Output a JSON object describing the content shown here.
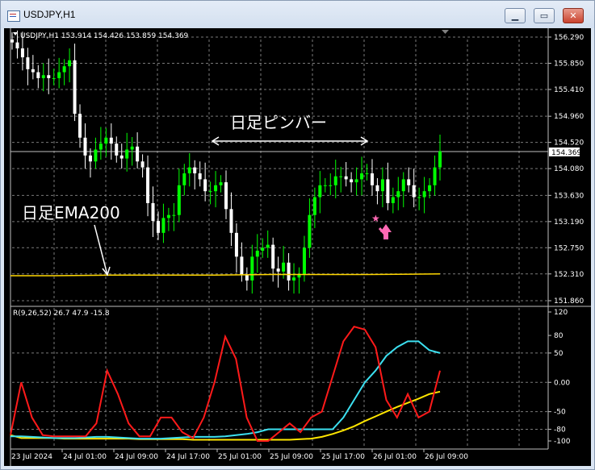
{
  "window": {
    "title": "USDJPY,H1",
    "buttons": {
      "minimize": "▁",
      "restore": "▭",
      "close": "✕"
    }
  },
  "main_chart": {
    "info": "USDJPY,H1  153.914 154.426 153.859 154.369",
    "current_price": "154.369",
    "price_ticks": [
      "156.290",
      "155.850",
      "155.410",
      "154.960",
      "154.520",
      "154.080",
      "153.630",
      "153.190",
      "152.750",
      "152.310",
      "151.860"
    ],
    "annotation_pinbar": "日足ピンバー",
    "annotation_ema": "日足EMA200",
    "colors": {
      "bull": "#00ff00",
      "bear": "#ffffff",
      "ema": "#ffd700",
      "arrow": "#ff69b4"
    }
  },
  "sub_chart": {
    "info": "R(9,26,52) 26.7 47.9 -15.8",
    "ticks": [
      "120",
      "80",
      "50",
      "0.00",
      "-50",
      "-80",
      "-100"
    ],
    "colors": {
      "red": "#ff1a1a",
      "cyan": "#3ce0f0",
      "yellow": "#ffe600"
    }
  },
  "time_axis": [
    "23 Jul 2024",
    "24 Jul 01:00",
    "24 Jul 09:00",
    "24 Jul 17:00",
    "25 Jul 01:00",
    "25 Jul 09:00",
    "25 Jul 17:00",
    "26 Jul 01:00",
    "26 Jul 09:00"
  ],
  "chart_data": [
    {
      "type": "candlestick",
      "title": "USDJPY,H1",
      "ylim": [
        151.86,
        156.29
      ],
      "close": [
        156.2,
        156.1,
        155.95,
        155.75,
        155.7,
        155.6,
        155.65,
        155.6,
        155.6,
        155.7,
        155.8,
        155.9,
        155.0,
        154.6,
        154.3,
        154.2,
        154.4,
        154.5,
        154.6,
        154.5,
        154.3,
        154.25,
        154.4,
        154.45,
        154.2,
        154.1,
        153.5,
        153.2,
        153.0,
        153.25,
        153.3,
        153.3,
        153.8,
        154.0,
        154.1,
        154.0,
        153.9,
        153.7,
        153.7,
        153.8,
        153.85,
        153.4,
        153.0,
        152.6,
        152.3,
        152.2,
        152.6,
        152.7,
        152.75,
        152.8,
        152.4,
        152.35,
        152.5,
        152.2,
        152.25,
        152.3,
        152.75,
        153.3,
        153.6,
        153.8,
        153.8,
        153.8,
        153.95,
        153.95,
        153.9,
        153.85,
        153.9,
        154.0,
        154.0,
        153.8,
        153.7,
        153.9,
        153.5,
        153.6,
        153.7,
        153.9,
        153.8,
        153.6,
        153.6,
        153.7,
        153.8,
        154.1,
        154.37
      ]
    },
    {
      "type": "line",
      "title": "R(9,26,52)",
      "ylim": [
        -100,
        120
      ],
      "series": [
        {
          "values": [
            -90,
            0,
            -60,
            -90,
            -92,
            -92,
            -92,
            -92,
            -70,
            20,
            -20,
            -70,
            -92,
            -92,
            -60,
            -60,
            -85,
            -95,
            -60,
            0,
            78,
            40,
            -60,
            -100,
            -100,
            -85,
            -70,
            -85,
            -60,
            -50,
            10,
            70,
            95,
            90,
            60,
            -30,
            -60,
            -20,
            -60,
            -50,
            20
          ]
        },
        {
          "values": [
            -92,
            -92,
            -93,
            -94,
            -95,
            -95,
            -95,
            -94,
            -93,
            -93,
            -94,
            -95,
            -96,
            -96,
            -96,
            -95,
            -94,
            -93,
            -93,
            -93,
            -92,
            -90,
            -88,
            -85,
            -80,
            -80,
            -80,
            -80,
            -80,
            -80,
            -80,
            -60,
            -30,
            0,
            20,
            45,
            60,
            70,
            70,
            55,
            50
          ]
        },
        {
          "values": [
            -90,
            -95,
            -95,
            -95,
            -95,
            -96,
            -96,
            -96,
            -96,
            -96,
            -96,
            -96,
            -97,
            -97,
            -97,
            -97,
            -97,
            -98,
            -98,
            -98,
            -98,
            -98,
            -98,
            -98,
            -98,
            -98,
            -98,
            -97,
            -96,
            -93,
            -88,
            -82,
            -75,
            -66,
            -58,
            -50,
            -42,
            -35,
            -28,
            -20,
            -15.8
          ]
        }
      ]
    }
  ]
}
